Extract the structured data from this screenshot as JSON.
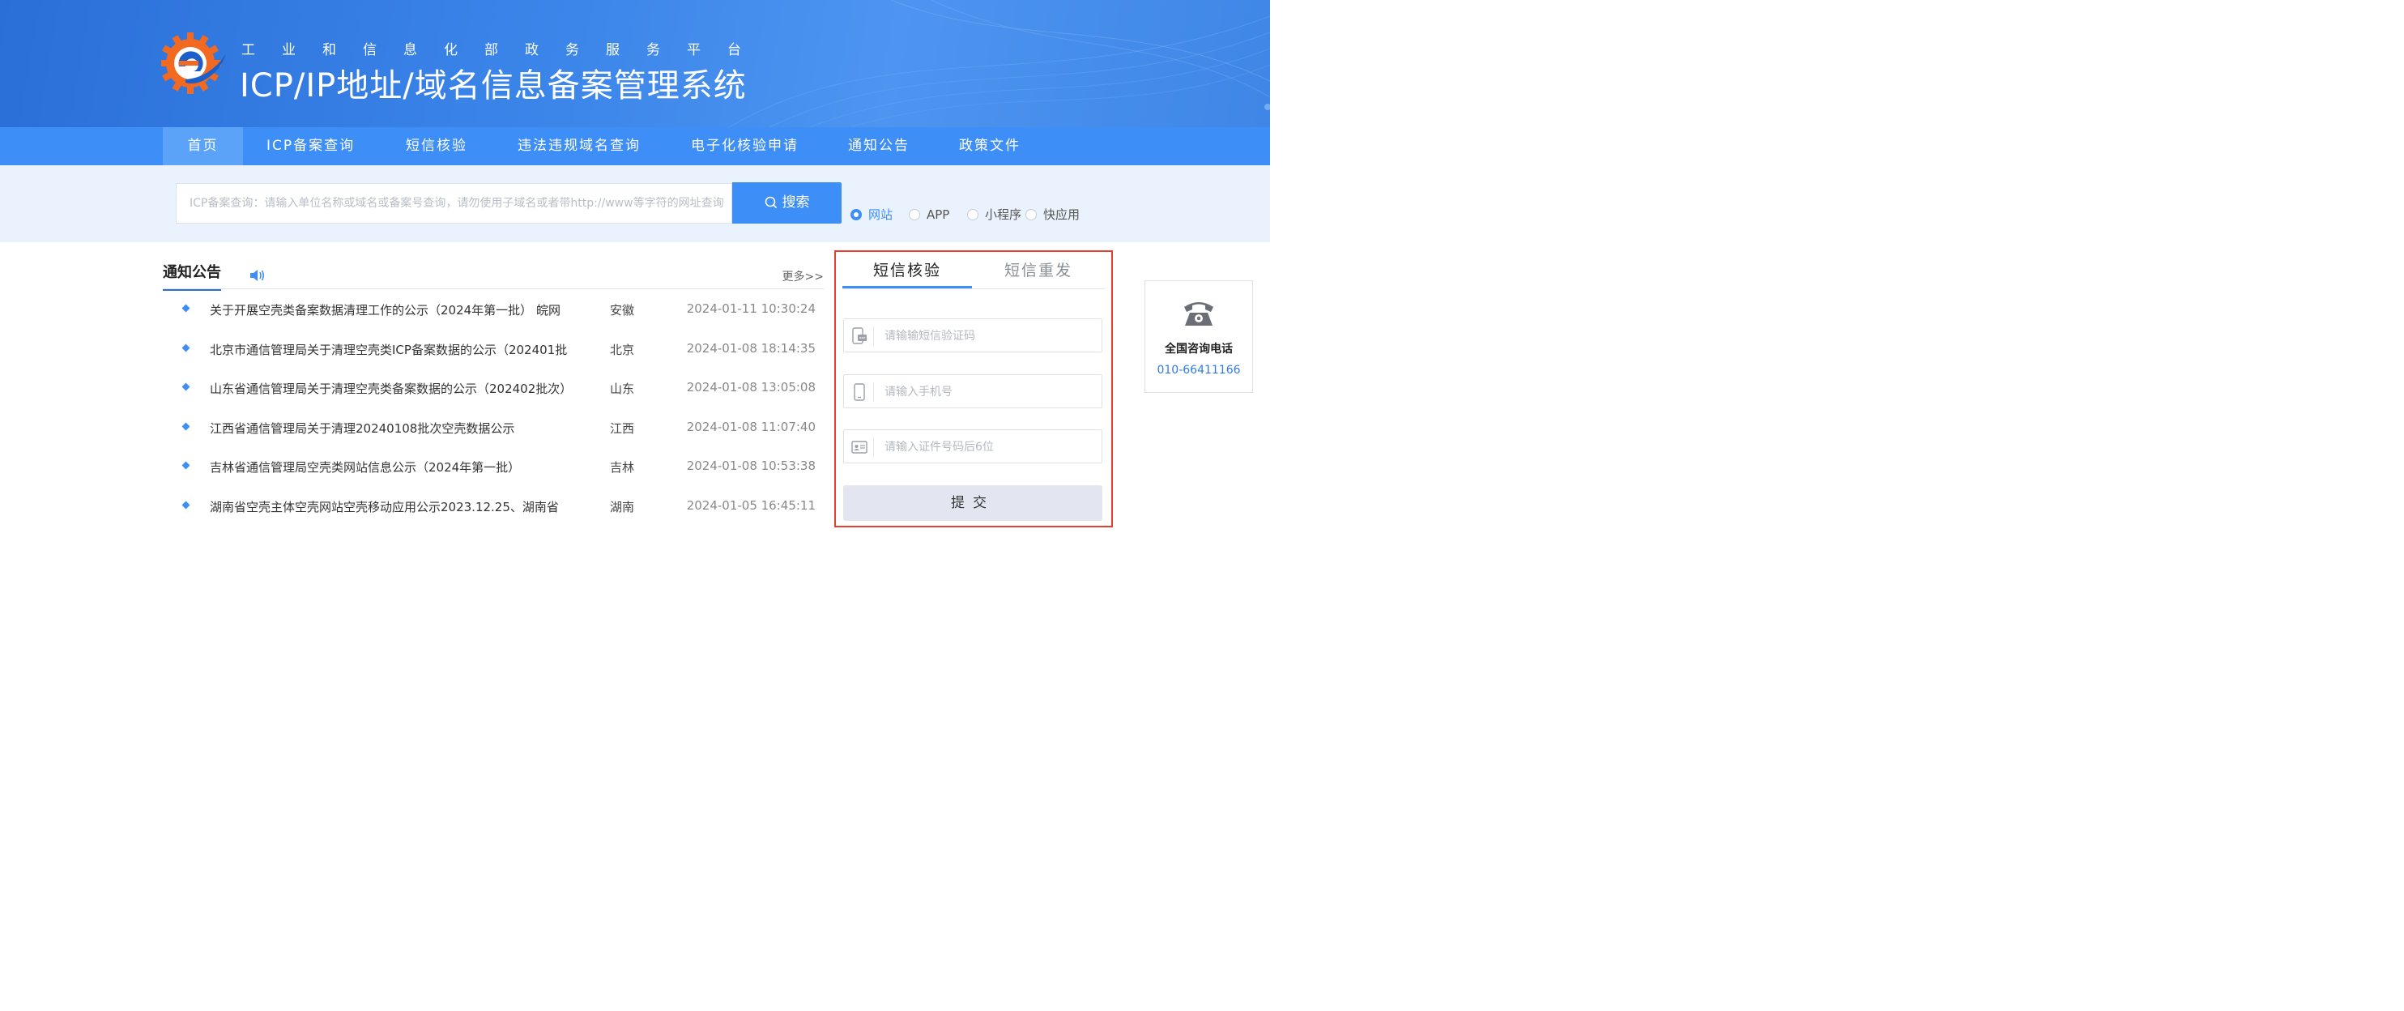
{
  "header": {
    "gov_name": "工业和信息化部政务服务平台",
    "system_title": "ICP/IP地址/域名信息备案管理系统"
  },
  "nav": {
    "items": [
      {
        "label": "首页",
        "active": true
      },
      {
        "label": "ICP备案查询"
      },
      {
        "label": "短信核验"
      },
      {
        "label": "违法违规域名查询"
      },
      {
        "label": "电子化核验申请"
      },
      {
        "label": "通知公告"
      },
      {
        "label": "政策文件"
      }
    ]
  },
  "search": {
    "placeholder": "ICP备案查询：请输入单位名称或域名或备案号查询，请勿使用子域名或者带http://www等字符的网址查询",
    "button_label": "搜索",
    "types": [
      {
        "label": "网站",
        "checked": true
      },
      {
        "label": "APP"
      },
      {
        "label": "小程序"
      },
      {
        "label": "快应用"
      }
    ]
  },
  "notices": {
    "title": "通知公告",
    "more_label": "更多>>",
    "items": [
      {
        "title": "关于开展空壳类备案数据清理工作的公示（2024年第一批） 皖网",
        "province": "安徽",
        "date": "2024-01-11 10:30:24"
      },
      {
        "title": "北京市通信管理局关于清理空壳类ICP备案数据的公示（202401批",
        "province": "北京",
        "date": "2024-01-08 18:14:35"
      },
      {
        "title": "山东省通信管理局关于清理空壳类备案数据的公示（202402批次）",
        "province": "山东",
        "date": "2024-01-08 13:05:08"
      },
      {
        "title": "江西省通信管理局关于清理20240108批次空壳数据公示",
        "province": "江西",
        "date": "2024-01-08 11:07:40"
      },
      {
        "title": "吉林省通信管理局空壳类网站信息公示（2024年第一批）",
        "province": "吉林",
        "date": "2024-01-08 10:53:38"
      },
      {
        "title": "湖南省空壳主体空壳网站空壳移动应用公示2023.12.25、湖南省",
        "province": "湖南",
        "date": "2024-01-05 16:45:11"
      }
    ]
  },
  "sms": {
    "tabs": [
      {
        "label": "短信核验",
        "active": true
      },
      {
        "label": "短信重发"
      }
    ],
    "fields": {
      "code_placeholder": "请输输短信验证码",
      "phone_placeholder": "请输入手机号",
      "id_placeholder": "请输入证件号码后6位"
    },
    "submit_label": "提交"
  },
  "hotline": {
    "label": "全国咨询电话",
    "number": "010-66411166"
  },
  "colors": {
    "primary": "#3e8ef7",
    "highlight_border": "#e5402f",
    "logo_orange": "#f26a21"
  }
}
